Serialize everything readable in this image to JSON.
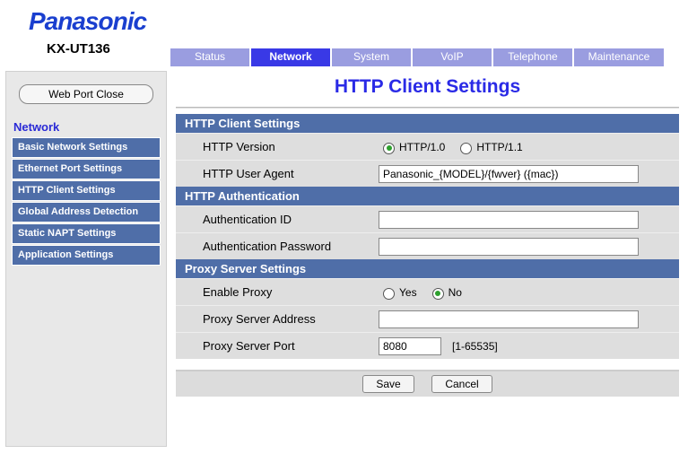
{
  "brand": "Panasonic",
  "model": "KX-UT136",
  "tabs": [
    {
      "label": "Status"
    },
    {
      "label": "Network",
      "active": true
    },
    {
      "label": "System"
    },
    {
      "label": "VoIP"
    },
    {
      "label": "Telephone"
    },
    {
      "label": "Maintenance"
    }
  ],
  "sidebar": {
    "webport_btn": "Web Port Close",
    "title": "Network",
    "items": [
      {
        "label": "Basic Network Settings"
      },
      {
        "label": "Ethernet Port Settings"
      },
      {
        "label": "HTTP Client Settings"
      },
      {
        "label": "Global Address Detection"
      },
      {
        "label": "Static NAPT Settings"
      },
      {
        "label": "Application Settings"
      }
    ]
  },
  "page_title": "HTTP Client Settings",
  "sections": {
    "http_client": {
      "header": "HTTP Client Settings",
      "version_label": "HTTP Version",
      "version_opt1": "HTTP/1.0",
      "version_opt2": "HTTP/1.1",
      "version_selected": "HTTP/1.0",
      "ua_label": "HTTP User Agent",
      "ua_value": "Panasonic_{MODEL}/{fwver} ({mac})"
    },
    "auth": {
      "header": "HTTP Authentication",
      "id_label": "Authentication ID",
      "id_value": "",
      "pw_label": "Authentication Password",
      "pw_value": ""
    },
    "proxy": {
      "header": "Proxy Server Settings",
      "enable_label": "Enable Proxy",
      "enable_yes": "Yes",
      "enable_no": "No",
      "enable_selected": "No",
      "addr_label": "Proxy Server Address",
      "addr_value": "",
      "port_label": "Proxy Server Port",
      "port_value": "8080",
      "port_hint": "[1-65535]"
    }
  },
  "buttons": {
    "save": "Save",
    "cancel": "Cancel"
  }
}
